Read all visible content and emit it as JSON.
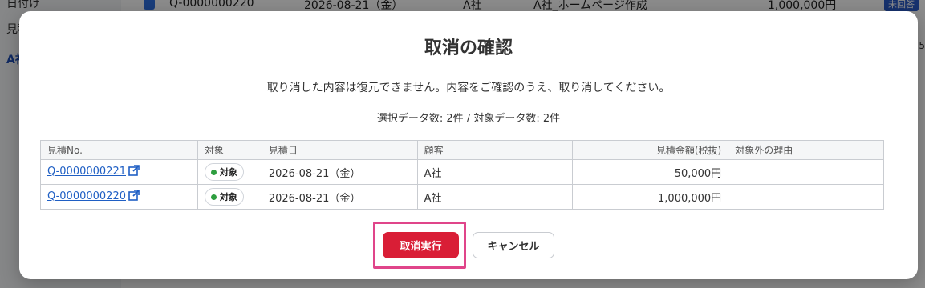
{
  "background": {
    "sidebar_items": [
      "日付け",
      "見積",
      "A社"
    ],
    "row": {
      "id": "Q-0000000220",
      "date": "2026-08-21（金）",
      "customer": "A社",
      "title": "A社_ホームページ作成",
      "amount": "1,000,000円",
      "badge": "未回答"
    },
    "peek": "5"
  },
  "modal": {
    "title": "取消の確認",
    "description": "取り消した内容は復元できません。内容をご確認のうえ、取り消してください。",
    "count": "選択データ数: 2件 / 対象データ数: 2件",
    "table": {
      "headers": [
        "見積No.",
        "対象",
        "見積日",
        "顧客",
        "見積金額(税抜)",
        "対象外の理由"
      ],
      "rows": [
        {
          "id": "Q-0000000221",
          "status": "対象",
          "date": "2026-08-21（金）",
          "customer": "A社",
          "amount": "50,000円",
          "reason": ""
        },
        {
          "id": "Q-0000000220",
          "status": "対象",
          "date": "2026-08-21（金）",
          "customer": "A社",
          "amount": "1,000,000円",
          "reason": ""
        }
      ]
    },
    "buttons": {
      "confirm": "取消実行",
      "cancel": "キャンセル"
    }
  },
  "colors": {
    "danger": "#d91e36",
    "focus_ring": "#e0458a",
    "link": "#1f5fc4",
    "status_dot": "#2e9e3f"
  }
}
